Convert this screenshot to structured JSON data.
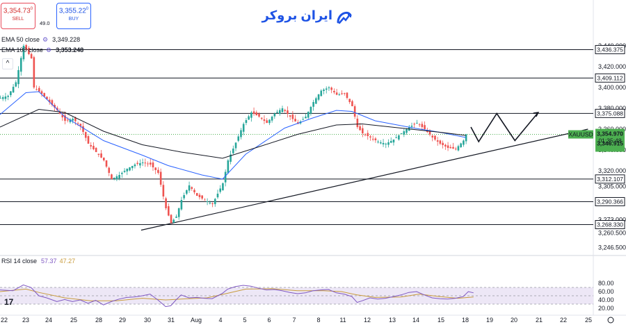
{
  "header": {
    "sell_price": "3,354.73",
    "sell_sup": "0",
    "sell_label": "SELL",
    "buy_price": "3,355.22",
    "buy_sup": "0",
    "buy_label": "BUY",
    "spread": "49.0",
    "logo_text": "ایران بروکر"
  },
  "indicators": {
    "ema50_label": "EMA 50 close",
    "ema50_value": "3,349.228",
    "ema100_label": "EMA 100 close",
    "ema100_value": "3,353.248",
    "rsi_label": "RSI 14 close",
    "rsi_value": "57.37",
    "rsi_ma_value": "47.27"
  },
  "colors": {
    "up_candle": "#26a69a",
    "down_candle": "#ef5350",
    "ema50": "#2962ff",
    "ema100": "#131722",
    "rsi": "#7e57c2",
    "rsi_ma": "#c89b3c",
    "current_price_bg": "#4caf50",
    "rsi_band": "#ede7f6"
  },
  "chart_data": [
    {
      "type": "candlestick",
      "symbol": "XAUUSD",
      "current_price": "3,354.970",
      "countdown": "01:35:48",
      "alt_price": "3,346.915",
      "y_axis_ticks": [
        "3,440.000",
        "3,420.000",
        "3,400.000",
        "3,380.000",
        "3,360.000",
        "3,340.000",
        "3,320.000",
        "3,305.000",
        "3,273.000",
        "3,260.500",
        "3,246.500"
      ],
      "ylim": [
        3240,
        3442
      ],
      "x_labels": [
        "22",
        "23",
        "24",
        "25",
        "28",
        "29",
        "30",
        "31",
        "Aug",
        "4",
        "5",
        "6",
        "7",
        "8",
        "11",
        "12",
        "13",
        "14",
        "15",
        "18",
        "19",
        "20",
        "21",
        "22",
        "25"
      ],
      "horizontal_levels": [
        {
          "value": 3436.375,
          "label": "3,436.375"
        },
        {
          "value": 3409.112,
          "label": "3,409.112"
        },
        {
          "value": 3375.088,
          "label": "3,375.088"
        },
        {
          "value": 3312.107,
          "label": "3,312.107"
        },
        {
          "value": 3290.366,
          "label": "3,290.366"
        },
        {
          "value": 3268.33,
          "label": "3,268.330"
        }
      ],
      "trendline": {
        "from": [
          23.9,
          3263.0
        ],
        "to": [
          238.0,
          3360.0
        ]
      },
      "projection": [
        [
          182,
          3362
        ],
        [
          185,
          3348
        ],
        [
          192,
          3375
        ],
        [
          199,
          3349
        ],
        [
          208,
          3376
        ]
      ],
      "path_points": [
        [
          0,
          3390
        ],
        [
          3,
          3392
        ],
        [
          6,
          3405
        ],
        [
          9,
          3440
        ],
        [
          12,
          3428
        ],
        [
          13,
          3400
        ],
        [
          16,
          3394
        ],
        [
          19,
          3386
        ],
        [
          22,
          3378
        ],
        [
          25,
          3368
        ],
        [
          28,
          3370
        ],
        [
          31,
          3363
        ],
        [
          34,
          3346
        ],
        [
          37,
          3338
        ],
        [
          40,
          3330
        ],
        [
          43,
          3312
        ],
        [
          46,
          3316
        ],
        [
          49,
          3322
        ],
        [
          52,
          3326
        ],
        [
          55,
          3328
        ],
        [
          58,
          3326
        ],
        [
          61,
          3318
        ],
        [
          64,
          3284
        ],
        [
          66,
          3270
        ],
        [
          68,
          3276
        ],
        [
          70,
          3292
        ],
        [
          73,
          3306
        ],
        [
          76,
          3296
        ],
        [
          79,
          3292
        ],
        [
          82,
          3288
        ],
        [
          86,
          3308
        ],
        [
          88,
          3330
        ],
        [
          91,
          3347
        ],
        [
          94,
          3365
        ],
        [
          97,
          3376
        ],
        [
          100,
          3372
        ],
        [
          103,
          3366
        ],
        [
          106,
          3375
        ],
        [
          109,
          3380
        ],
        [
          112,
          3372
        ],
        [
          115,
          3365
        ],
        [
          118,
          3372
        ],
        [
          121,
          3386
        ],
        [
          124,
          3397
        ],
        [
          127,
          3400
        ],
        [
          130,
          3393
        ],
        [
          133,
          3394
        ],
        [
          136,
          3382
        ],
        [
          138,
          3362
        ],
        [
          140,
          3356
        ],
        [
          143,
          3352
        ],
        [
          146,
          3348
        ],
        [
          149,
          3346
        ],
        [
          152,
          3350
        ],
        [
          155,
          3356
        ],
        [
          158,
          3362
        ],
        [
          161,
          3366
        ],
        [
          164,
          3360
        ],
        [
          167,
          3352
        ],
        [
          170,
          3346
        ],
        [
          173,
          3342
        ],
        [
          176,
          3341
        ],
        [
          179,
          3349
        ],
        [
          180,
          3355
        ]
      ],
      "ema50": [
        [
          0,
          3374
        ],
        [
          10,
          3395
        ],
        [
          15,
          3396
        ],
        [
          25,
          3372
        ],
        [
          40,
          3349
        ],
        [
          55,
          3335
        ],
        [
          65,
          3325
        ],
        [
          78,
          3316
        ],
        [
          86,
          3312
        ],
        [
          95,
          3336
        ],
        [
          110,
          3361
        ],
        [
          120,
          3370
        ],
        [
          130,
          3378
        ],
        [
          136,
          3377
        ],
        [
          145,
          3368
        ],
        [
          160,
          3361
        ],
        [
          170,
          3357
        ],
        [
          180,
          3352
        ]
      ],
      "ema100": [
        [
          0,
          3362
        ],
        [
          15,
          3379
        ],
        [
          25,
          3376
        ],
        [
          40,
          3358
        ],
        [
          55,
          3345
        ],
        [
          70,
          3338
        ],
        [
          86,
          3332
        ],
        [
          100,
          3343
        ],
        [
          115,
          3355
        ],
        [
          130,
          3364
        ],
        [
          140,
          3365
        ],
        [
          155,
          3361
        ],
        [
          170,
          3357
        ],
        [
          180,
          3354
        ]
      ]
    },
    {
      "type": "line",
      "name": "RSI 14 close",
      "y_axis_ticks": [
        "80.00",
        "60.00",
        "40.00",
        "20.00"
      ],
      "ylim": [
        15,
        85
      ],
      "bands": [
        70,
        50,
        30
      ],
      "rsi": [
        [
          0,
          64
        ],
        [
          5,
          62
        ],
        [
          9,
          76
        ],
        [
          12,
          70
        ],
        [
          15,
          50
        ],
        [
          18,
          45
        ],
        [
          22,
          36
        ],
        [
          25,
          41
        ],
        [
          28,
          36
        ],
        [
          31,
          40
        ],
        [
          34,
          32
        ],
        [
          37,
          39
        ],
        [
          40,
          28
        ],
        [
          43,
          36
        ],
        [
          46,
          42
        ],
        [
          49,
          46
        ],
        [
          52,
          47
        ],
        [
          55,
          50
        ],
        [
          58,
          54
        ],
        [
          61,
          40
        ],
        [
          64,
          24
        ],
        [
          66,
          26
        ],
        [
          68,
          40
        ],
        [
          70,
          52
        ],
        [
          73,
          45
        ],
        [
          76,
          46
        ],
        [
          79,
          44
        ],
        [
          82,
          43
        ],
        [
          86,
          56
        ],
        [
          88,
          66
        ],
        [
          91,
          72
        ],
        [
          94,
          75
        ],
        [
          97,
          73
        ],
        [
          100,
          68
        ],
        [
          103,
          64
        ],
        [
          106,
          65
        ],
        [
          109,
          62
        ],
        [
          112,
          58
        ],
        [
          115,
          55
        ],
        [
          118,
          57
        ],
        [
          121,
          62
        ],
        [
          124,
          64
        ],
        [
          127,
          65
        ],
        [
          130,
          57
        ],
        [
          133,
          54
        ],
        [
          136,
          48
        ],
        [
          138,
          34
        ],
        [
          140,
          38
        ],
        [
          143,
          45
        ],
        [
          146,
          42
        ],
        [
          149,
          44
        ],
        [
          152,
          48
        ],
        [
          155,
          52
        ],
        [
          158,
          58
        ],
        [
          161,
          60
        ],
        [
          164,
          52
        ],
        [
          167,
          45
        ],
        [
          170,
          43
        ],
        [
          173,
          42
        ],
        [
          176,
          44
        ],
        [
          179,
          48
        ],
        [
          181,
          60
        ],
        [
          183,
          57
        ]
      ],
      "rsi_ma": [
        [
          0,
          60
        ],
        [
          10,
          66
        ],
        [
          15,
          58
        ],
        [
          25,
          45
        ],
        [
          35,
          38
        ],
        [
          45,
          38
        ],
        [
          55,
          44
        ],
        [
          64,
          40
        ],
        [
          70,
          42
        ],
        [
          80,
          45
        ],
        [
          88,
          56
        ],
        [
          95,
          66
        ],
        [
          105,
          67
        ],
        [
          115,
          62
        ],
        [
          125,
          62
        ],
        [
          132,
          60
        ],
        [
          138,
          52
        ],
        [
          145,
          46
        ],
        [
          155,
          47
        ],
        [
          162,
          54
        ],
        [
          170,
          48
        ],
        [
          177,
          44
        ],
        [
          183,
          47
        ]
      ]
    }
  ]
}
